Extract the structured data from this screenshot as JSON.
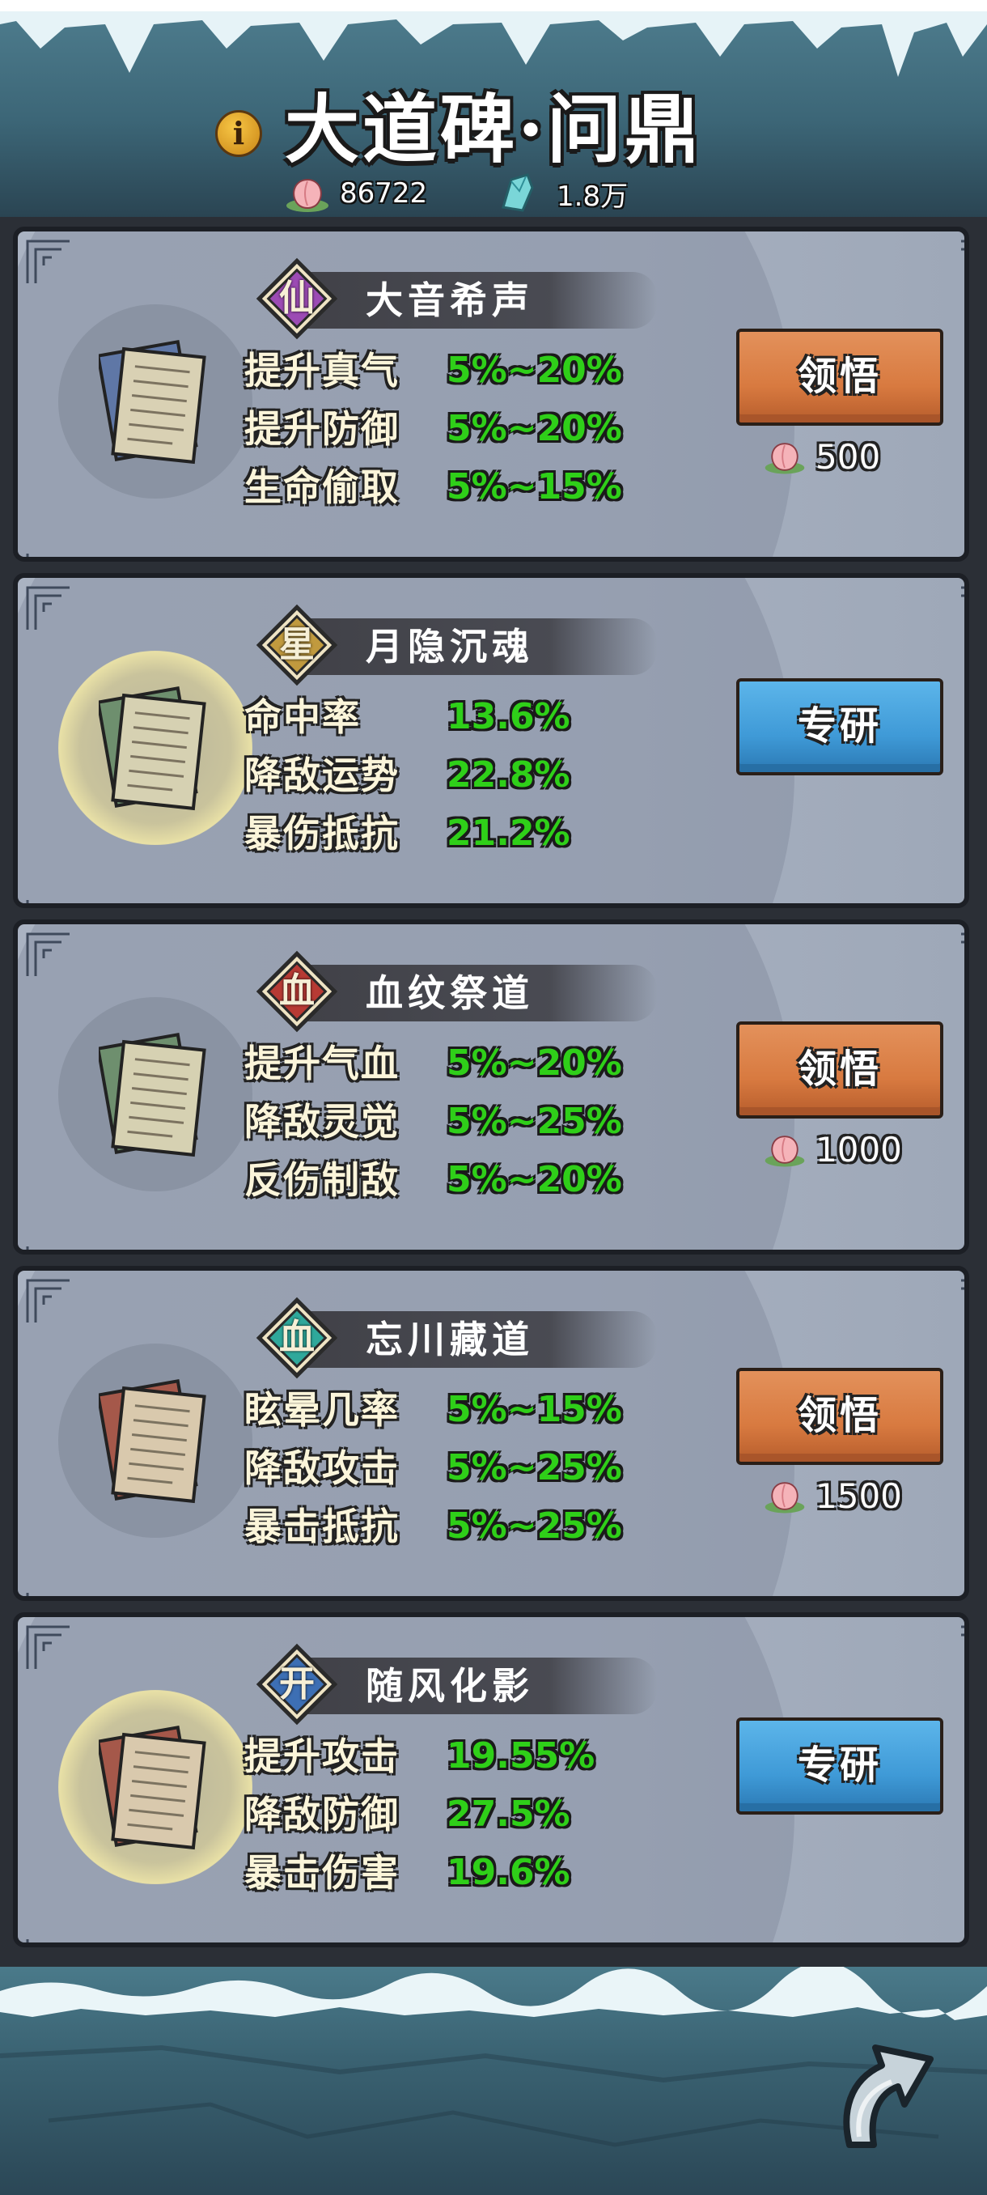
{
  "header": {
    "title": "大道碑·问鼎",
    "info_label": "i",
    "peach_count": "86722",
    "jade_count": "1.8万"
  },
  "colors": {
    "stat_green": "#2fcf19",
    "button_orange": "#d87a40",
    "button_blue": "#3f9ad7",
    "badge_purple": "#9c4bb4",
    "badge_gold": "#c19a3e",
    "badge_red": "#b73a34",
    "badge_teal": "#2fa89b",
    "badge_blue": "#3d6fb4"
  },
  "cards": [
    {
      "badge": "仙",
      "badge_color": "purple",
      "name": "大音希声",
      "scroll_color": "blue",
      "stats": [
        {
          "label": "提升真气",
          "value": "5%~20%"
        },
        {
          "label": "提升防御",
          "value": "5%~20%"
        },
        {
          "label": "生命偷取",
          "value": "5%~15%"
        }
      ],
      "button": "领悟",
      "button_style": "orange",
      "cost": "500"
    },
    {
      "badge": "星",
      "badge_color": "gold",
      "name": "月隐沉魂",
      "scroll_color": "green",
      "stats": [
        {
          "label": "命中率",
          "value": "13.6%"
        },
        {
          "label": "降敌运势",
          "value": "22.8%"
        },
        {
          "label": "暴伤抵抗",
          "value": "21.2%"
        }
      ],
      "button": "专研",
      "button_style": "blue"
    },
    {
      "badge": "血",
      "badge_color": "red",
      "name": "血纹祭道",
      "scroll_color": "green",
      "stats": [
        {
          "label": "提升气血",
          "value": "5%~20%"
        },
        {
          "label": "降敌灵觉",
          "value": "5%~25%"
        },
        {
          "label": "反伤制敌",
          "value": "5%~20%"
        }
      ],
      "button": "领悟",
      "button_style": "orange",
      "cost": "1000"
    },
    {
      "badge": "血",
      "badge_color": "teal",
      "name": "忘川藏道",
      "scroll_color": "red",
      "stats": [
        {
          "label": "眩晕几率",
          "value": "5%~15%"
        },
        {
          "label": "降敌攻击",
          "value": "5%~25%"
        },
        {
          "label": "暴击抵抗",
          "value": "5%~25%"
        }
      ],
      "button": "领悟",
      "button_style": "orange",
      "cost": "1500"
    },
    {
      "badge": "开",
      "badge_color": "blue",
      "name": "随风化影",
      "scroll_color": "red",
      "stats": [
        {
          "label": "提升攻击",
          "value": "19.55%"
        },
        {
          "label": "降敌防御",
          "value": "27.5%"
        },
        {
          "label": "暴击伤害",
          "value": "19.6%"
        }
      ],
      "button": "专研",
      "button_style": "blue"
    }
  ]
}
